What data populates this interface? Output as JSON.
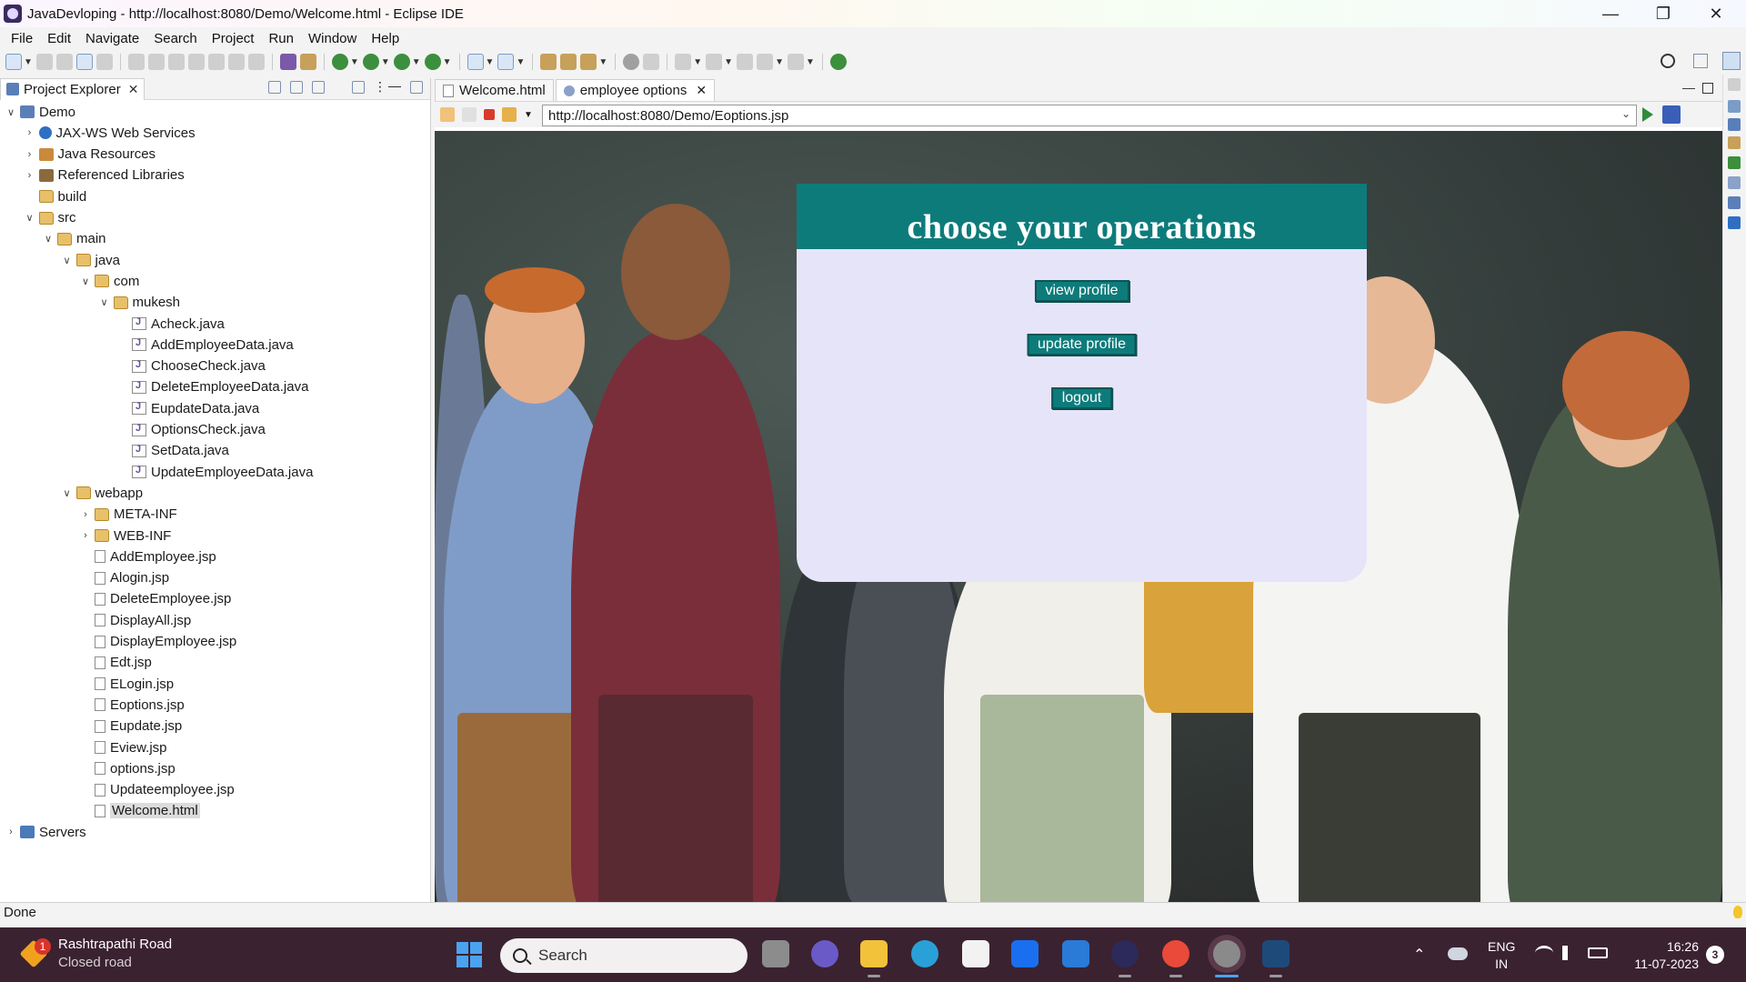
{
  "window": {
    "title": "JavaDevloping - http://localhost:8080/Demo/Welcome.html - Eclipse IDE",
    "controls": [
      "minimize-icon",
      "restore-icon",
      "close-icon"
    ]
  },
  "menu": [
    "File",
    "Edit",
    "Navigate",
    "Search",
    "Project",
    "Run",
    "Window",
    "Help"
  ],
  "explorer": {
    "tab_label": "Project Explorer",
    "tree": [
      {
        "label": "Demo",
        "icon": "project-icon",
        "depth": 0,
        "expanded": true
      },
      {
        "label": "JAX-WS Web Services",
        "icon": "webservice-icon",
        "depth": 1,
        "expanded": false
      },
      {
        "label": "Java Resources",
        "icon": "java-resources-icon",
        "depth": 1,
        "expanded": false
      },
      {
        "label": "Referenced Libraries",
        "icon": "library-icon",
        "depth": 1,
        "expanded": false
      },
      {
        "label": "build",
        "icon": "folder-icon",
        "depth": 1,
        "expanded": null
      },
      {
        "label": "src",
        "icon": "folder-icon",
        "depth": 1,
        "expanded": true
      },
      {
        "label": "main",
        "icon": "folder-icon",
        "depth": 2,
        "expanded": true
      },
      {
        "label": "java",
        "icon": "folder-icon",
        "depth": 3,
        "expanded": true
      },
      {
        "label": "com",
        "icon": "folder-icon",
        "depth": 4,
        "expanded": true
      },
      {
        "label": "mukesh",
        "icon": "folder-icon",
        "depth": 5,
        "expanded": true
      },
      {
        "label": "Acheck.java",
        "icon": "java-file-icon",
        "depth": 6
      },
      {
        "label": "AddEmployeeData.java",
        "icon": "java-file-icon",
        "depth": 6
      },
      {
        "label": "ChooseCheck.java",
        "icon": "java-file-icon",
        "depth": 6
      },
      {
        "label": "DeleteEmployeeData.java",
        "icon": "java-file-icon",
        "depth": 6
      },
      {
        "label": "EupdateData.java",
        "icon": "java-file-icon",
        "depth": 6
      },
      {
        "label": "OptionsCheck.java",
        "icon": "java-file-icon",
        "depth": 6
      },
      {
        "label": "SetData.java",
        "icon": "java-file-icon",
        "depth": 6
      },
      {
        "label": "UpdateEmployeeData.java",
        "icon": "java-file-icon",
        "depth": 6
      },
      {
        "label": "webapp",
        "icon": "folder-icon",
        "depth": 3,
        "expanded": true
      },
      {
        "label": "META-INF",
        "icon": "folder-icon",
        "depth": 4,
        "expanded": false
      },
      {
        "label": "WEB-INF",
        "icon": "folder-icon",
        "depth": 4,
        "expanded": false
      },
      {
        "label": "AddEmployee.jsp",
        "icon": "jsp-file-icon",
        "depth": 4
      },
      {
        "label": "Alogin.jsp",
        "icon": "jsp-file-icon",
        "depth": 4
      },
      {
        "label": "DeleteEmployee.jsp",
        "icon": "jsp-file-icon",
        "depth": 4
      },
      {
        "label": "DisplayAll.jsp",
        "icon": "jsp-file-icon",
        "depth": 4
      },
      {
        "label": "DisplayEmployee.jsp",
        "icon": "jsp-file-icon",
        "depth": 4
      },
      {
        "label": "Edt.jsp",
        "icon": "jsp-file-icon",
        "depth": 4
      },
      {
        "label": "ELogin.jsp",
        "icon": "jsp-file-icon",
        "depth": 4
      },
      {
        "label": "Eoptions.jsp",
        "icon": "jsp-file-icon",
        "depth": 4
      },
      {
        "label": "Eupdate.jsp",
        "icon": "jsp-file-icon",
        "depth": 4
      },
      {
        "label": "Eview.jsp",
        "icon": "jsp-file-icon",
        "depth": 4
      },
      {
        "label": "options.jsp",
        "icon": "jsp-file-icon",
        "depth": 4
      },
      {
        "label": "Updateemployee.jsp",
        "icon": "jsp-file-icon",
        "depth": 4
      },
      {
        "label": "Welcome.html",
        "icon": "html-file-icon",
        "depth": 4,
        "selected": true
      },
      {
        "label": "Servers",
        "icon": "server-folder-icon",
        "depth": 0,
        "expanded": false
      }
    ]
  },
  "editor": {
    "tabs": [
      {
        "label": "Welcome.html",
        "active": false
      },
      {
        "label": "employee options",
        "active": true
      }
    ],
    "url": "http://localhost:8080/Demo/Eoptions.jsp"
  },
  "page": {
    "heading": "choose your operations",
    "buttons": [
      "view profile",
      "update profile",
      "logout"
    ],
    "colors": {
      "header": "#0e7b7b",
      "panel": "#e6e4f8",
      "button": "#0e7b7b"
    }
  },
  "status": {
    "text": "Done"
  },
  "taskbar": {
    "widget_line1": "Rashtrapathi Road",
    "widget_line2": "Closed road",
    "widget_badge": "1",
    "search_placeholder": "Search",
    "lang_line1": "ENG",
    "lang_line2": "IN",
    "time": "16:26",
    "date": "11-07-2023",
    "notifications": "3"
  }
}
